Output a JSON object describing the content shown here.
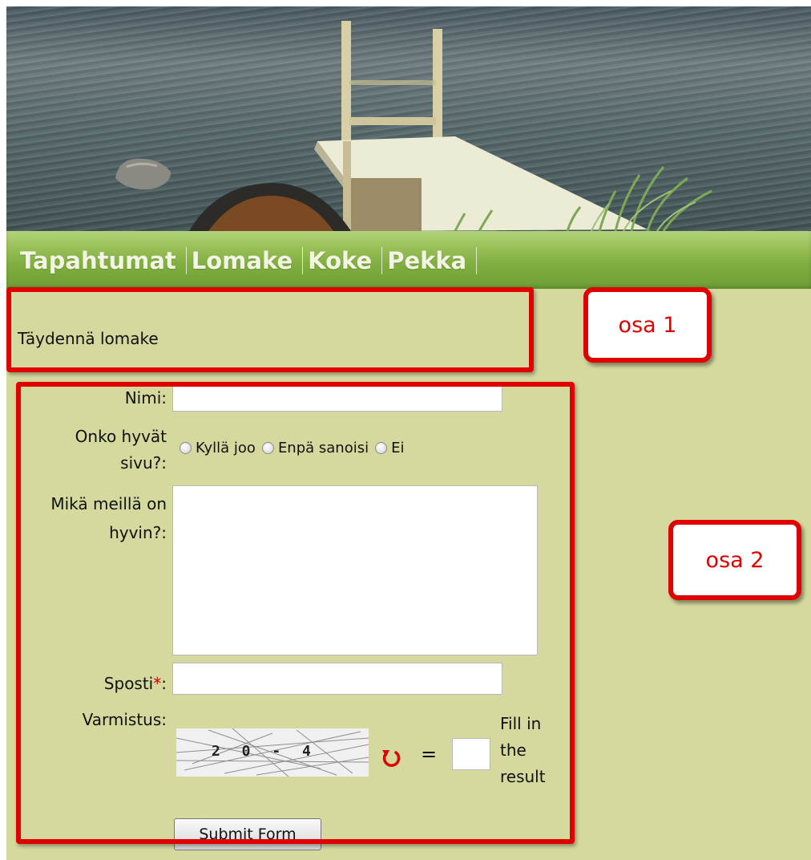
{
  "nav": {
    "items": [
      {
        "label": "Tapahtumat"
      },
      {
        "label": "Lomake"
      },
      {
        "label": "Koke"
      },
      {
        "label": "Pekka"
      }
    ]
  },
  "intro": {
    "text": "Täydennä lomake"
  },
  "annotations": {
    "callout1": "osa 1",
    "callout2": "osa 2",
    "color": "#e00000"
  },
  "form": {
    "name_label": "Nimi:",
    "name_value": "",
    "rating_label_line1": "Onko hyvät",
    "rating_label_line2": "sivu?:",
    "rating_options": [
      "Kyllä joo",
      "Enpä sanoisi",
      "Ei"
    ],
    "likes_label_line1": "Mikä meillä on",
    "likes_label_line2": "hyvin?:",
    "likes_value": "",
    "email_label": "Sposti",
    "email_required_marker": "*",
    "email_label_suffix": ":",
    "email_value": "",
    "verify_label": "Varmistus:",
    "captcha_text": "2 0 - 4",
    "equals": "=",
    "captcha_hint_line1": "Fill in",
    "captcha_hint_line2": "the",
    "captcha_hint_line3": "result",
    "submit_label": "Submit Form"
  },
  "colors": {
    "page_background": "#d5d99e",
    "nav_green": "#7fad3f",
    "annotation_red": "#e00000"
  }
}
